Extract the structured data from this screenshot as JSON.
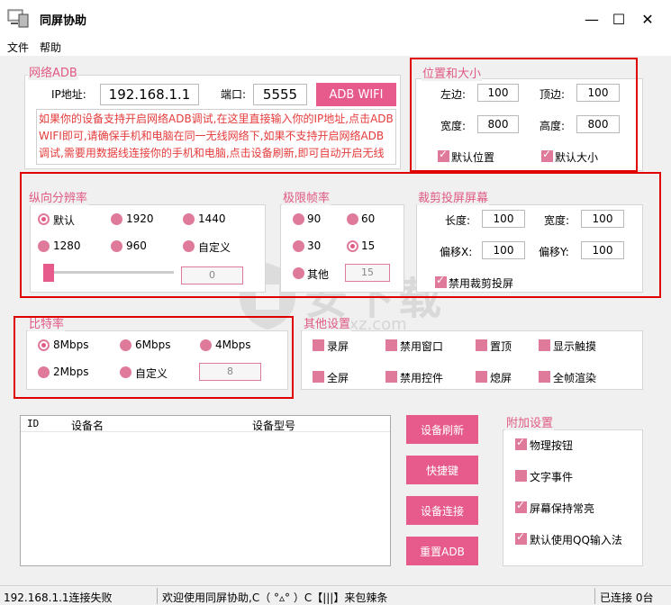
{
  "window": {
    "title": "同屏协助",
    "minimize": "—",
    "maximize": "☐",
    "close": "✕"
  },
  "menu": [
    "文件",
    "帮助"
  ],
  "adb": {
    "group": "网络ADB",
    "ip_label": "IP地址:",
    "ip_value": "192.168.1.1",
    "port_label": "端口:",
    "port_value": "5555",
    "button": "ADB WIFI",
    "hint": "如果你的设备支持开启网络ADB调试,在这里直接输入你的IP地址,点击ADB WIFI即可,请确保手机和电脑在同一无线网络下,如果不支持开启网络ADB调试,需要用数据线连接你的手机和电脑,点击设备刷新,即可自动开启无线连接!"
  },
  "position": {
    "group": "位置和大小",
    "left_label": "左边:",
    "left_value": "100",
    "top_label": "顶边:",
    "top_value": "100",
    "width_label": "宽度:",
    "width_value": "800",
    "height_label": "高度:",
    "height_value": "800",
    "default_pos": "默认位置",
    "default_size": "默认大小"
  },
  "resolution": {
    "group": "纵向分辨率",
    "options": [
      "默认",
      "1920",
      "1440",
      "1280",
      "960",
      "自定义"
    ],
    "custom_value": "0",
    "slider_value": 0
  },
  "framerate": {
    "group": "极限帧率",
    "options": [
      "90",
      "60",
      "30",
      "15",
      "其他"
    ],
    "other_value": "15"
  },
  "crop": {
    "group": "裁剪投屏屏幕",
    "length_label": "长度:",
    "length_value": "100",
    "width_label": "宽度:",
    "width_value": "100",
    "offx_label": "偏移X:",
    "offx_value": "100",
    "offy_label": "偏移Y:",
    "offy_value": "100",
    "disable": "禁用裁剪投屏"
  },
  "bitrate": {
    "group": "比特率",
    "options": [
      "8Mbps",
      "6Mbps",
      "4Mbps",
      "2Mbps",
      "自定义"
    ],
    "custom_value": "8"
  },
  "other": {
    "group": "其他设置",
    "options": [
      "录屏",
      "禁用窗口",
      "置顶",
      "显示触摸",
      "全屏",
      "禁用控件",
      "熄屏",
      "全帧渲染"
    ]
  },
  "devices": {
    "col_id": "ID",
    "col_name": "设备名",
    "col_model": "设备型号"
  },
  "actions": {
    "refresh": "设备刷新",
    "shortcut": "快捷键",
    "connect": "设备连接",
    "reset": "重置ADB"
  },
  "extra": {
    "group": "附加设置",
    "options": [
      "物理按钮",
      "文字事件",
      "屏幕保持常亮",
      "默认使用QQ输入法"
    ]
  },
  "watermark": "安下载",
  "watermark_url": "anxz.com",
  "status": {
    "left": "192.168.1.1连接失败",
    "middle": "欢迎使用同屏协助,C（ °▵° ）C【|||】来包辣条",
    "right": "已连接 0台"
  },
  "colors": {
    "accent": "#e65b8b",
    "highlight_box": "#e00000"
  }
}
